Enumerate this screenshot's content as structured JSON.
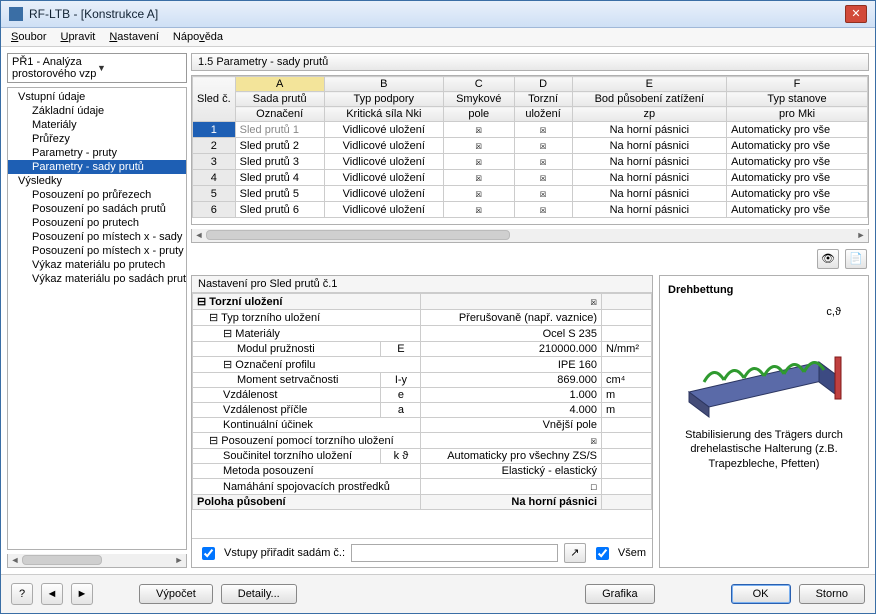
{
  "window": {
    "title": "RF-LTB - [Konstrukce A]"
  },
  "menu": {
    "file": "Soubor",
    "edit": "Upravit",
    "settings": "Nastavení",
    "help": "Nápověda"
  },
  "combo": {
    "selected": "PŘ1 - Analýza prostorového vzp"
  },
  "tree": {
    "inputs": "Vstupní údaje",
    "basic": "Základní údaje",
    "materials": "Materiály",
    "sections": "Průřezy",
    "param_members": "Parametry - pruty",
    "param_sets": "Parametry - sady prutů",
    "results": "Výsledky",
    "r1": "Posouzení po průřezech",
    "r2": "Posouzení po sadách prutů",
    "r3": "Posouzení po prutech",
    "r4": "Posouzení po místech x - sady",
    "r5": "Posouzení po místech x - pruty",
    "r6": "Výkaz materiálu po prutech",
    "r7": "Výkaz materiálu po sadách prut"
  },
  "grid": {
    "title": "1.5 Parametry - sady prutů",
    "headers": {
      "num": "Sled\nč.",
      "A1": "Sada prutů",
      "A2": "Označení",
      "B1": "Typ podpory",
      "B2": "Kritická síla Nki",
      "C1": "Smykové",
      "C2": "pole",
      "D1": "Torzní",
      "D2": "uložení",
      "E1": "Bod působení zatížení",
      "E2": "zp",
      "F1": "Typ stanove",
      "F2": "pro Mki"
    },
    "colLetters": {
      "A": "A",
      "B": "B",
      "C": "C",
      "D": "D",
      "E": "E",
      "F": "F"
    },
    "rows": [
      {
        "n": "1",
        "name": "Sled prutů 1",
        "support": "Vidlicové uložení",
        "shear": "☒",
        "tors": "☒",
        "load": "Na horní pásnici",
        "type": "Automaticky pro vše"
      },
      {
        "n": "2",
        "name": "Sled prutů 2",
        "support": "Vidlicové uložení",
        "shear": "☒",
        "tors": "☒",
        "load": "Na horní pásnici",
        "type": "Automaticky pro vše"
      },
      {
        "n": "3",
        "name": "Sled prutů 3",
        "support": "Vidlicové uložení",
        "shear": "☒",
        "tors": "☒",
        "load": "Na horní pásnici",
        "type": "Automaticky pro vše"
      },
      {
        "n": "4",
        "name": "Sled prutů 4",
        "support": "Vidlicové uložení",
        "shear": "☒",
        "tors": "☒",
        "load": "Na horní pásnici",
        "type": "Automaticky pro vše"
      },
      {
        "n": "5",
        "name": "Sled prutů 5",
        "support": "Vidlicové uložení",
        "shear": "☒",
        "tors": "☒",
        "load": "Na horní pásnici",
        "type": "Automaticky pro vše"
      },
      {
        "n": "6",
        "name": "Sled prutů 6",
        "support": "Vidlicové uložení",
        "shear": "☒",
        "tors": "☒",
        "load": "Na horní pásnici",
        "type": "Automaticky pro vše"
      }
    ]
  },
  "props": {
    "title": "Nastavení pro Sled prutů č.1",
    "sec_torsion": "Torzní uložení",
    "tors_check": "☒",
    "type_support": "Typ torzního uložení",
    "type_support_val": "Přerušovaně (např. vaznice)",
    "materials": "Materiály",
    "materials_val": "Ocel S 235",
    "emod": "Modul pružnosti",
    "emod_sym": "E",
    "emod_val": "210000.000",
    "emod_unit": "N/mm²",
    "profile": "Označení profilu",
    "profile_val": "IPE 160",
    "inertia": "Moment setrvačnosti",
    "inertia_sym": "I-y",
    "inertia_val": "869.000",
    "inertia_unit": "cm⁴",
    "dist": "Vzdálenost",
    "dist_sym": "e",
    "dist_val": "1.000",
    "dist_unit": "m",
    "dist_p": "Vzdálenost příčle",
    "dist_p_sym": "a",
    "dist_p_val": "4.000",
    "dist_p_unit": "m",
    "cont": "Kontinuální účinek",
    "cont_val": "Vnější pole",
    "assess": "Posouzení pomocí torzního uložení",
    "assess_chk": "☒",
    "coef": "Součinitel torzního uložení",
    "coef_sym": "k ϑ",
    "coef_val": "Automaticky pro všechny ZS/S",
    "method": "Metoda posouzení",
    "method_val": "Elastický - elastický",
    "conn": "Namáhání spojovacích prostředků",
    "conn_chk": "☐",
    "sec_pos": "Poloha působení",
    "pos_val": "Na horní pásnici",
    "footer_label": "Vstupy přiřadit sadám č.:",
    "footer_all": "Všem"
  },
  "graphic": {
    "title": "Drehbettung",
    "label": "c,ϑ",
    "text": "Stabilisierung des Trägers durch drehelastische Halterung (z.B. Trapezbleche, Pfetten)"
  },
  "buttons": {
    "calc": "Výpočet",
    "details": "Detaily...",
    "graphics": "Grafika",
    "ok": "OK",
    "cancel": "Storno"
  }
}
